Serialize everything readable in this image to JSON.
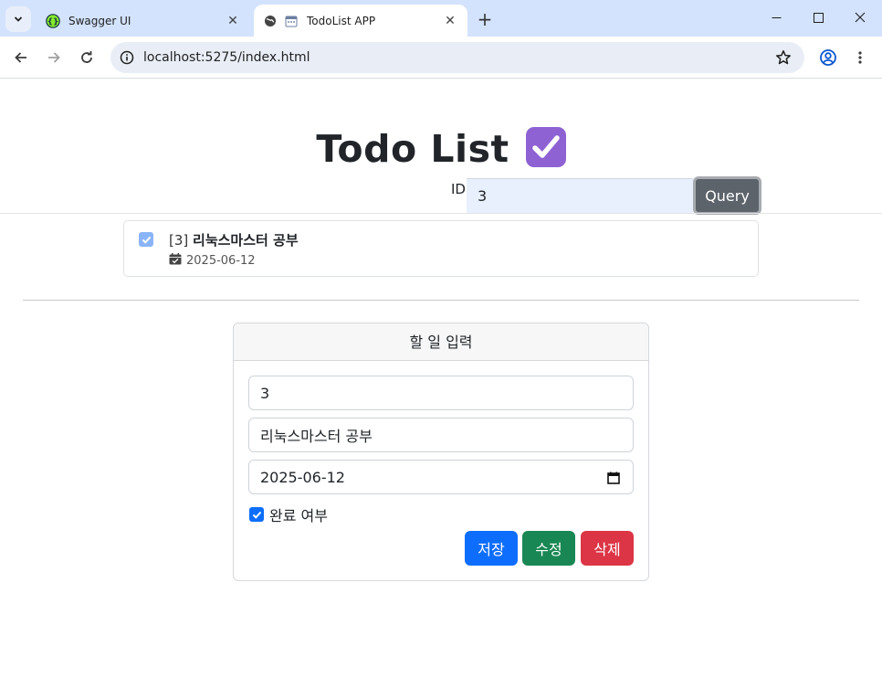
{
  "browser": {
    "tabs": [
      {
        "title": "Swagger UI",
        "icon": "swagger-icon",
        "active": false
      },
      {
        "title": "TodoList APP",
        "icon": "globe-icon",
        "active": true
      }
    ],
    "url": "localhost:5275/index.html"
  },
  "page": {
    "title": "Todo List",
    "title_icon": "check-box-emoji",
    "query": {
      "label": "ID",
      "value": "3",
      "button_label": "Query"
    },
    "result": {
      "id_text": "[3]",
      "name": "리눅스마스터 공부",
      "date": "2025-06-12",
      "completed": true
    },
    "form": {
      "header": "할 일 입력",
      "id_value": "3",
      "name_value": "리눅스마스터 공부",
      "date_value": "2025-06-12",
      "done_label": "완료 여부",
      "done_checked": true,
      "save_label": "저장",
      "edit_label": "수정",
      "delete_label": "삭제"
    }
  },
  "colors": {
    "primary": "#0d6efd",
    "success": "#198754",
    "danger": "#dc3545",
    "secondary": "#5c636a",
    "tabstrip": "#d3e3fd"
  }
}
